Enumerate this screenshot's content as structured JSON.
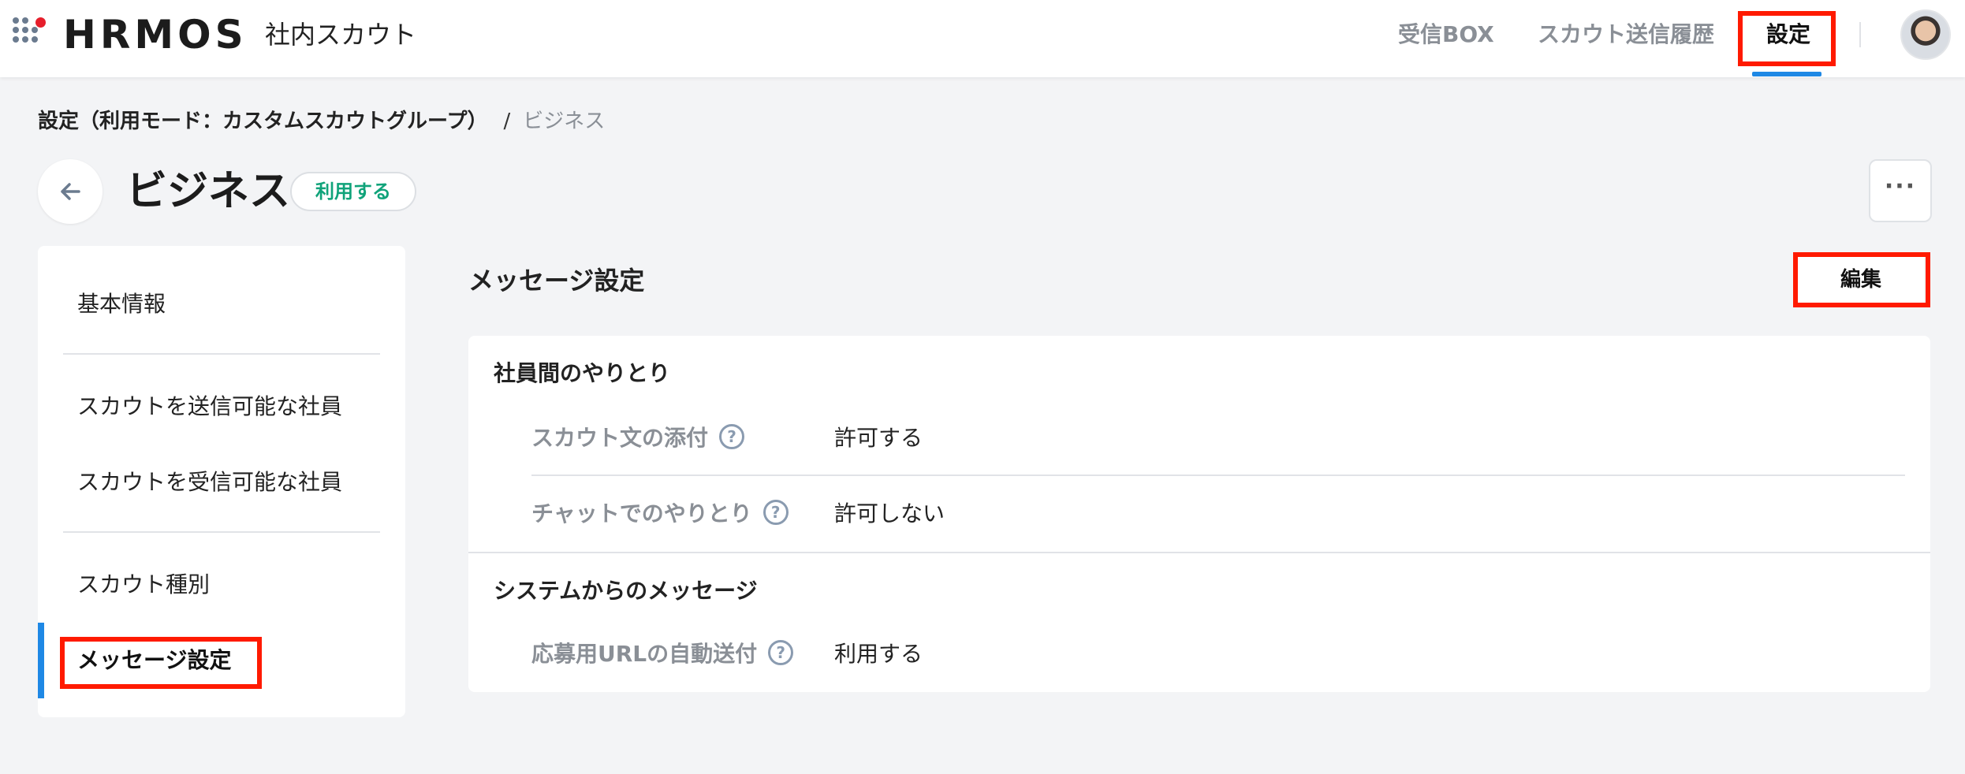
{
  "header": {
    "logo": "HRMOS",
    "product": "社内スカウト",
    "nav": [
      {
        "label": "受信BOX"
      },
      {
        "label": "スカウト送信履歴"
      },
      {
        "label": "設定"
      }
    ]
  },
  "breadcrumb": {
    "parent": "設定（利用モード：カスタムスカウトグループ）",
    "separator": "/",
    "current": "ビジネス"
  },
  "title": {
    "text": "ビジネス",
    "badge": "利用する",
    "more": "···"
  },
  "sidebar": {
    "items": [
      {
        "label": "基本情報"
      },
      {
        "label": "スカウトを送信可能な社員"
      },
      {
        "label": "スカウトを受信可能な社員"
      },
      {
        "label": "スカウト種別"
      },
      {
        "label": "メッセージ設定"
      }
    ]
  },
  "main": {
    "section_title": "メッセージ設定",
    "edit_label": "編集",
    "groups": [
      {
        "title": "社員間のやりとり",
        "rows": [
          {
            "label": "スカウト文の添付",
            "help": "?",
            "value": "許可する"
          },
          {
            "label": "チャットでのやりとり",
            "help": "?",
            "value": "許可しない"
          }
        ]
      },
      {
        "title": "システムからのメッセージ",
        "rows": [
          {
            "label": "応募用URLの自動送付",
            "help": "?",
            "value": "利用する"
          }
        ]
      }
    ]
  },
  "colors": {
    "accent": "#1e88e5",
    "badge_text": "#10a37a",
    "highlight": "#ff1a00",
    "logo_dot": "#e61e2b"
  }
}
